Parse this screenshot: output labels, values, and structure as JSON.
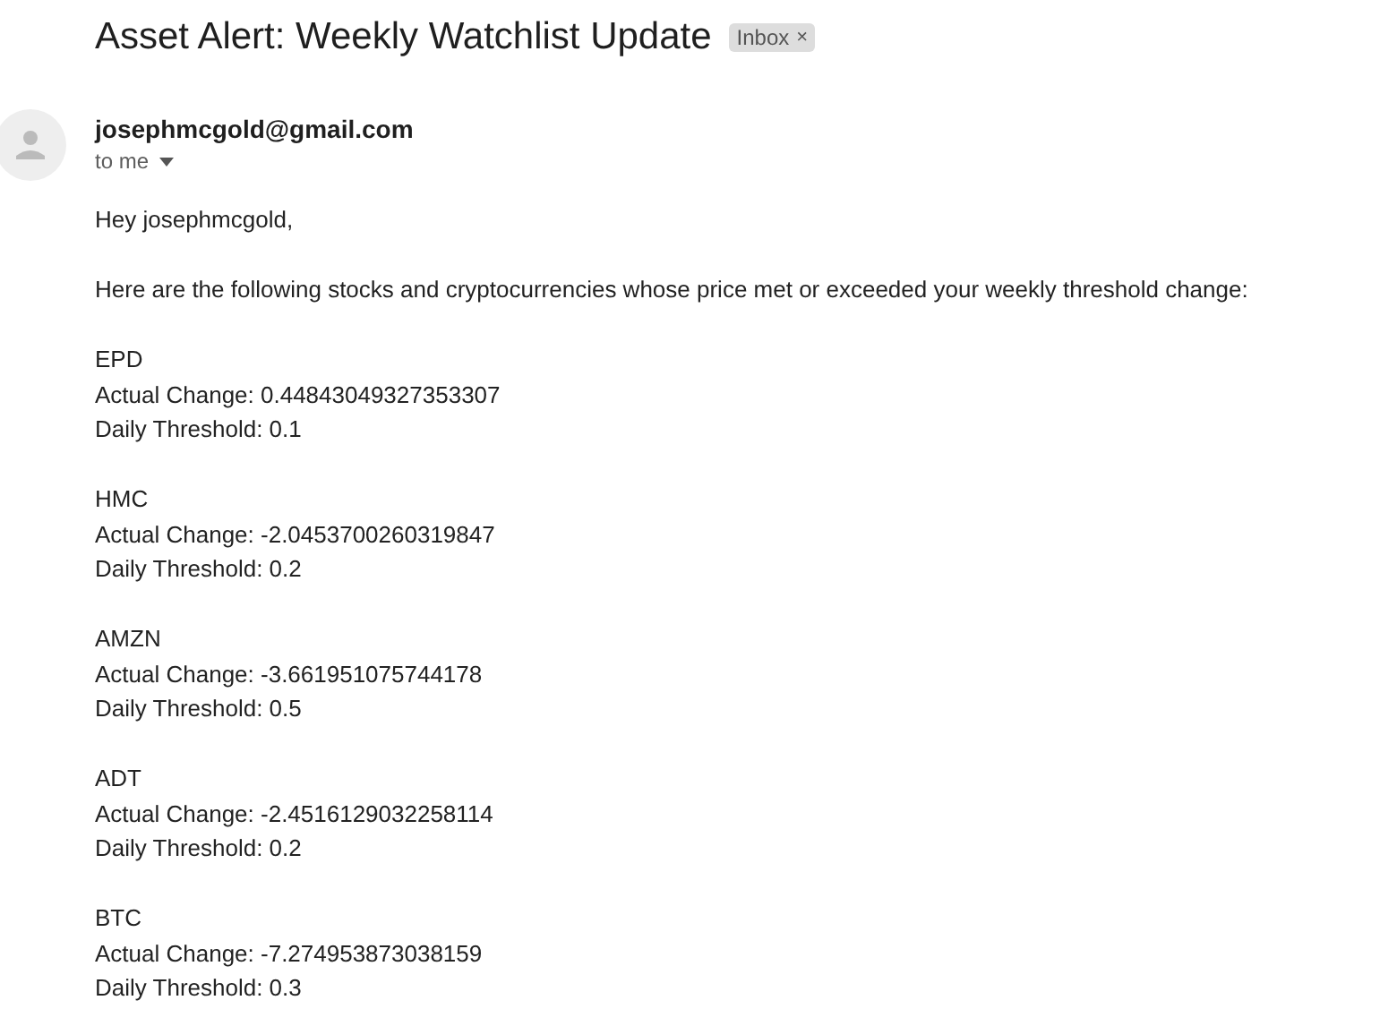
{
  "email": {
    "subject": "Asset Alert: Weekly Watchlist Update",
    "label": {
      "text": "Inbox",
      "close": "×"
    },
    "sender": "josephmcgold@gmail.com",
    "recipient": "to me",
    "greeting": "Hey josephmcgold,",
    "intro": "Here are the following stocks and cryptocurrencies whose price met or exceeded your weekly threshold change:",
    "assets": [
      {
        "ticker": "EPD",
        "actual_change": "Actual Change: 0.44843049327353307",
        "threshold": "Daily Threshold: 0.1"
      },
      {
        "ticker": "HMC",
        "actual_change": "Actual Change: -2.0453700260319847",
        "threshold": "Daily Threshold: 0.2"
      },
      {
        "ticker": "AMZN",
        "actual_change": "Actual Change: -3.661951075744178",
        "threshold": "Daily Threshold: 0.5"
      },
      {
        "ticker": "ADT",
        "actual_change": "Actual Change: -2.4516129032258114",
        "threshold": "Daily Threshold: 0.2"
      },
      {
        "ticker": "BTC",
        "actual_change": "Actual Change: -7.274953873038159",
        "threshold": "Daily Threshold: 0.3"
      }
    ]
  }
}
